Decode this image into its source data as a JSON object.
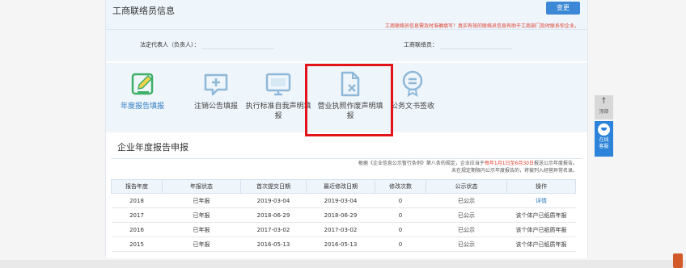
{
  "contact": {
    "title": "工商联络员信息",
    "change_button": "变更",
    "notice": "工商联络员信息需及时准确填写！真实有效的联络员信息有助于工商部门及时联系你企业。",
    "legal_rep_label": "法定代表人（负责人）：",
    "legal_rep_value": "",
    "contact_label": "工商联络员：",
    "contact_value": ""
  },
  "services": [
    {
      "label": "年度报告填报",
      "icon": "form-edit-icon"
    },
    {
      "label": "注销公告填报",
      "icon": "notice-plus-icon"
    },
    {
      "label": "执行标准自我声明填报",
      "icon": "monitor-icon"
    },
    {
      "label": "营业执照作废声明填报",
      "icon": "document-cancel-icon"
    },
    {
      "label": "公务文书签收",
      "icon": "official-document-icon"
    }
  ],
  "annual_report": {
    "title": "企业年度报告申报",
    "note_prefix": "根据《企业信息公示暂行条例》第八条的规定，企业应当于",
    "note_highlight": "每年1月1日至6月30日",
    "note_suffix": "报送公示年度报告。",
    "note_line2": "未在规定期限内公示年度报告的，将被列入经营异常名录。",
    "columns": [
      "报告年度",
      "年报状态",
      "首次提交日期",
      "最近修改日期",
      "修改次数",
      "公示状态",
      "操作"
    ],
    "rows": [
      {
        "year": "2018",
        "status": "已年报",
        "first": "2019-03-04",
        "last": "2019-03-04",
        "times": "0",
        "public": "已公示",
        "action": "详情"
      },
      {
        "year": "2017",
        "status": "已年报",
        "first": "2018-06-29",
        "last": "2018-06-29",
        "times": "0",
        "public": "已公示",
        "action": "该个体户已纸质年报"
      },
      {
        "year": "2016",
        "status": "已年报",
        "first": "2017-03-02",
        "last": "2017-03-02",
        "times": "0",
        "public": "已公示",
        "action": "该个体户已纸质年报"
      },
      {
        "year": "2015",
        "status": "已年报",
        "first": "2016-05-13",
        "last": "2016-05-13",
        "times": "0",
        "public": "已公示",
        "action": "该个体户已纸质年报"
      }
    ]
  },
  "sidebar": {
    "top_label": "顶部",
    "chat_label_1": "在线",
    "chat_label_2": "客服"
  },
  "colors": {
    "accent": "#2e7bc3",
    "highlight_box": "#e3131a",
    "warning_text": "#e03b2a",
    "panel_bg": "#eef5fb"
  }
}
